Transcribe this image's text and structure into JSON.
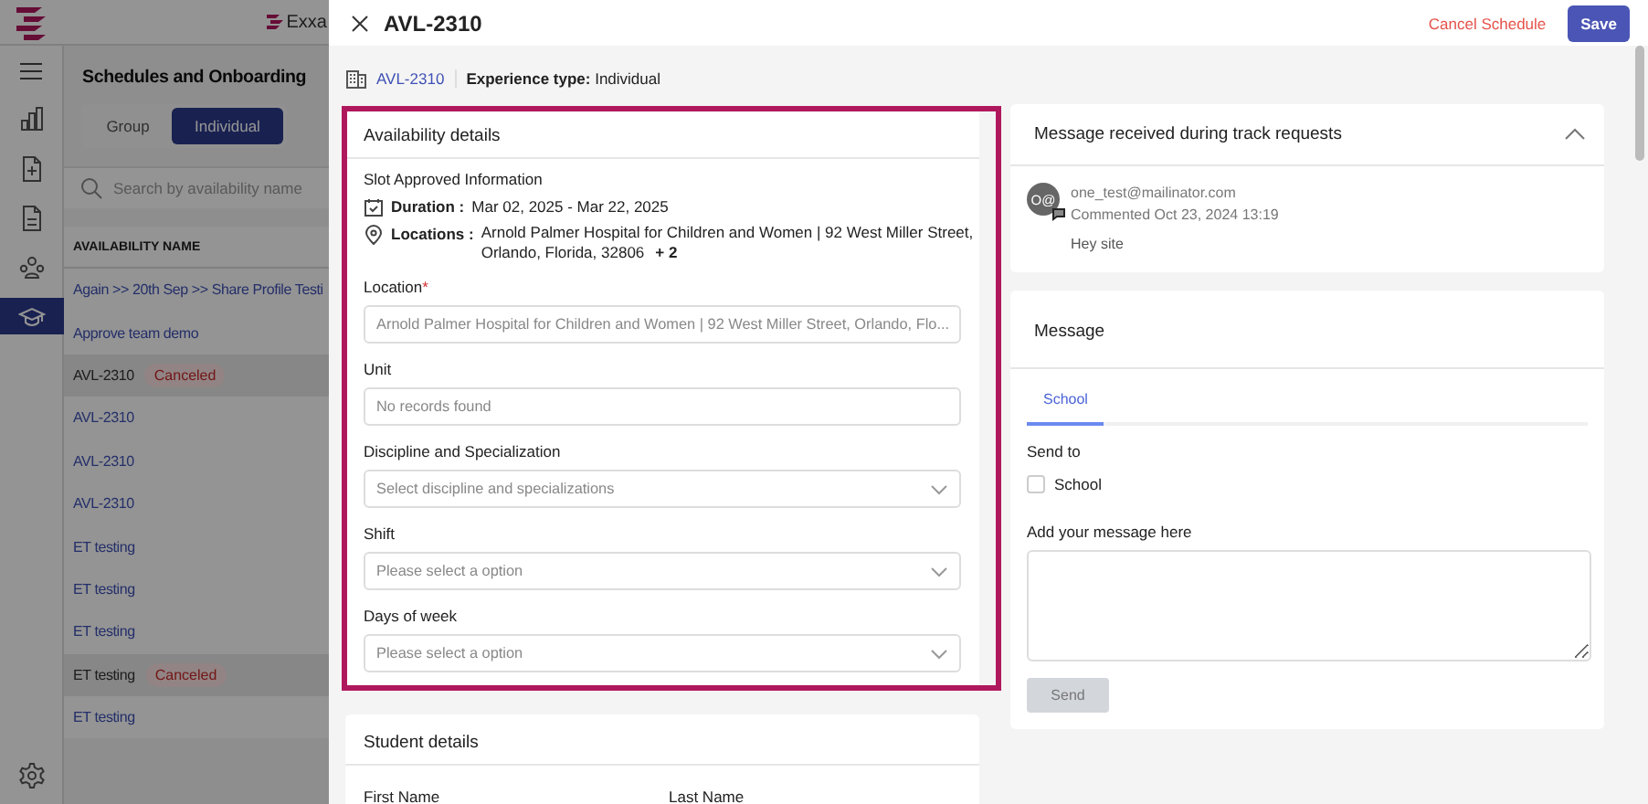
{
  "app": {
    "logo_text": "Exxa",
    "nav": [
      {
        "selected": false
      },
      {
        "selected": false
      },
      {
        "selected": false
      },
      {
        "selected": false
      },
      {
        "selected": true
      },
      {
        "selected": false
      }
    ],
    "page_title": "Schedules and Onboarding",
    "toggle": [
      {
        "label": "Group",
        "selected": false
      },
      {
        "label": "Individual",
        "selected": true
      }
    ],
    "search": {
      "placeholder": "Search by availability name"
    },
    "column": "AVAILABILITY NAME",
    "rows": [
      {
        "name": "Again >> 20th Sep >> Share Profile Testi"
      },
      {
        "name": "Approve team demo"
      },
      {
        "name": "AVL-2310",
        "badge": "Canceled"
      },
      {
        "name": "AVL-2310"
      },
      {
        "name": "AVL-2310"
      },
      {
        "name": "AVL-2310"
      },
      {
        "name": "ET testing"
      },
      {
        "name": "ET testing"
      },
      {
        "name": "ET testing"
      },
      {
        "name": "ET testing",
        "badge": "Canceled"
      },
      {
        "name": "ET testing"
      }
    ]
  },
  "drawer": {
    "title": "AVL-2310",
    "cancel": "Cancel Schedule",
    "save": "Save",
    "ref": "AVL-2310",
    "experience": "**Experience type:** Individual",
    "availability": {
      "title": "Availability details",
      "highlighted": true,
      "section": "Slot Approved Information",
      "duration_label": "Duration :",
      "duration": "Mar 02, 2025 - Mar 22, 2025",
      "locations_label": "Locations :",
      "locations_lines": [
        "Arnold Palmer Hospital for Children and Women | 92 West Miller Street,",
        "Orlando, Florida, 32806"
      ],
      "locations_more": "+ 2",
      "fields": [
        {
          "kind": "select",
          "label": "Location",
          "required_mark": "*",
          "value": "Arnold Palmer Hospital for Children and Women | 92 West Miller Street, Orlando, Flo..."
        },
        {
          "kind": "input",
          "label": "Unit",
          "placeholder": "No records found"
        },
        {
          "kind": "select",
          "label": "Discipline and Specialization",
          "placeholder": "Select discipline and specializations"
        },
        {
          "kind": "select",
          "label": "Shift",
          "placeholder": "Please select a option"
        },
        {
          "kind": "select",
          "label": "Days of week",
          "placeholder": "Please select a option"
        }
      ]
    },
    "student": {
      "title": "Student details",
      "labels": [
        "First Name",
        "Last Name"
      ]
    },
    "messages": {
      "title": "Message received during track requests",
      "expanded": true,
      "comments": [
        {
          "initials": "O@",
          "author": "one_test@mailinator.com",
          "time": "Commented Oct 23, 2024 13:19",
          "text": "Hey site"
        }
      ]
    },
    "compose": {
      "title": "Message",
      "tabs": [
        {
          "label": "School",
          "selected": true
        }
      ],
      "send_to": "Send to",
      "recipients": [
        {
          "label": "School",
          "checked": false
        }
      ],
      "message_label": "Add your message here",
      "send": "Send",
      "send_disabled": true
    }
  }
}
